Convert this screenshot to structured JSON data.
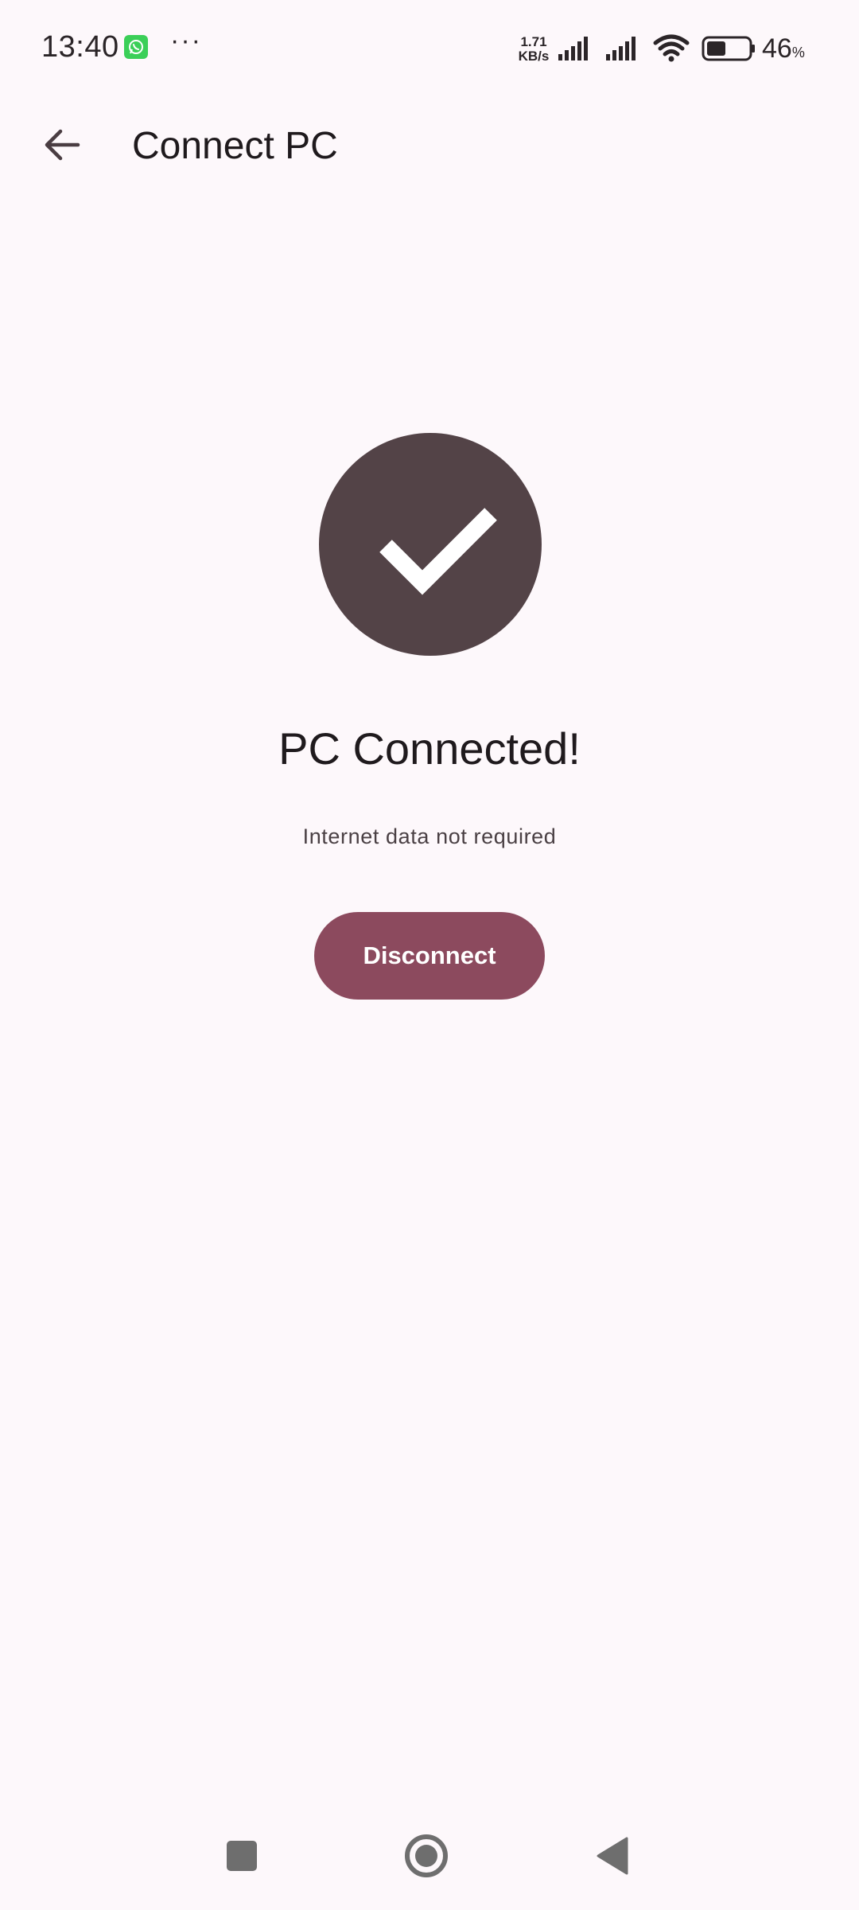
{
  "status_bar": {
    "time": "13:40",
    "more_indicator": "···",
    "net_speed_value": "1.71",
    "net_speed_unit": "KB/s",
    "battery_percent": "46",
    "battery_percent_sign": "%",
    "battery_level": 0.46,
    "icons": [
      "whatsapp-icon",
      "signal-icon",
      "signal-icon",
      "wifi-icon",
      "battery-icon"
    ]
  },
  "app_bar": {
    "back_icon": "arrow-back-icon",
    "title": "Connect PC"
  },
  "main": {
    "status_icon": "check-icon",
    "headline": "PC Connected!",
    "subtext": "Internet data not required",
    "disconnect_label": "Disconnect"
  },
  "nav_bar": {
    "icons": [
      "recents-icon",
      "home-icon",
      "back-icon"
    ]
  },
  "colors": {
    "background": "#fdf8fb",
    "check_circle": "#534347",
    "button_primary": "#8c4a5e",
    "text_primary": "#1f1a1d"
  }
}
